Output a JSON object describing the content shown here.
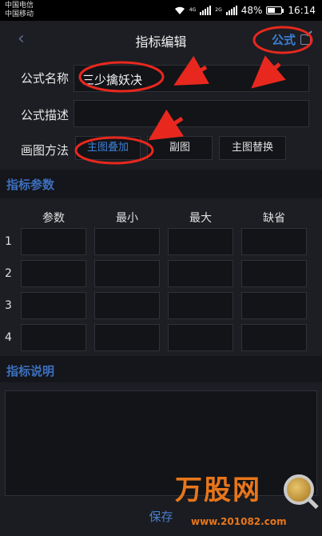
{
  "status_bar": {
    "carrier1": "中国电信",
    "carrier2": "中国移动",
    "net1": "4G",
    "net2": "2G",
    "battery": "48%",
    "time": "16:14"
  },
  "nav": {
    "back_icon": "chevron-left-icon",
    "title": "指标编辑",
    "formula_label": "公式",
    "formula_icon": "edit-icon"
  },
  "form": {
    "name_label": "公式名称",
    "name_value": "三少擒妖决",
    "desc_label": "公式描述",
    "desc_value": "",
    "draw_label": "画图方法",
    "draw_options": [
      "主图叠加",
      "副图",
      "主图替换"
    ],
    "draw_selected": "主图叠加"
  },
  "params_section": {
    "title": "指标参数",
    "columns": [
      "参数",
      "最小",
      "最大",
      "缺省"
    ],
    "rows": [
      "1",
      "2",
      "3",
      "4"
    ]
  },
  "desc_section": {
    "title": "指标说明"
  },
  "footer": {
    "save_label": "保存"
  },
  "watermark": {
    "brand": "万股网",
    "url": "www.201082.com"
  },
  "colors": {
    "accent": "#3d7fd6",
    "background": "#1c1e23",
    "annotation": "#e8281e",
    "watermark": "#e8761b"
  }
}
